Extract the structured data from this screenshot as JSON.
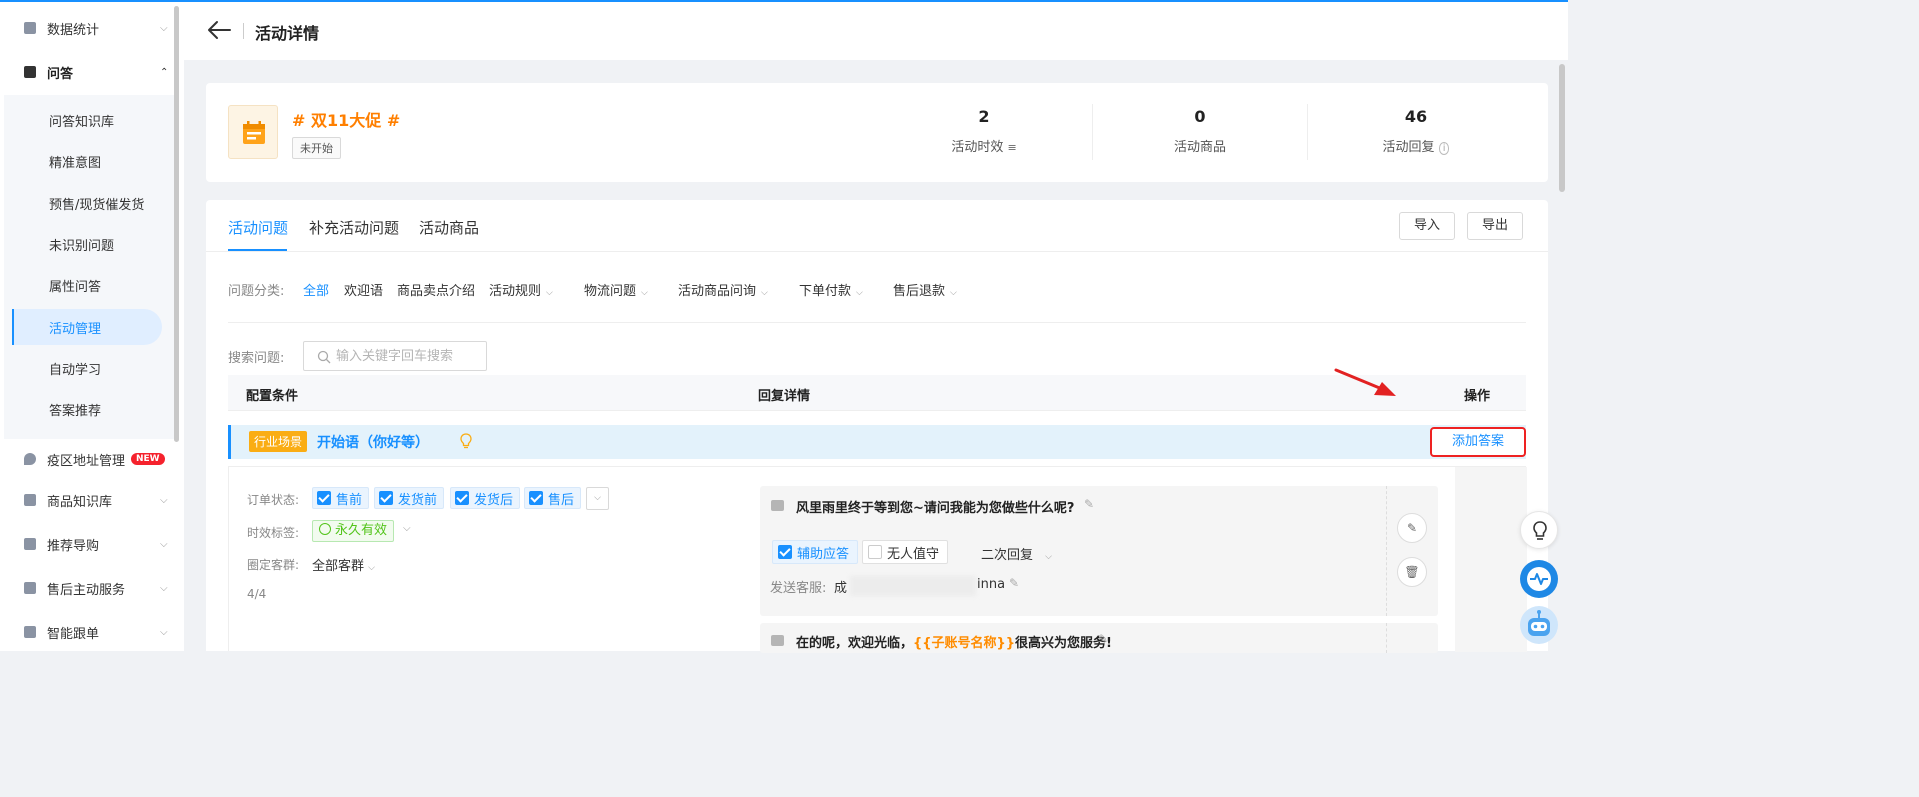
{
  "sidebar": {
    "items": [
      {
        "label": "数据统计",
        "icon": "chart-icon"
      },
      {
        "label": "问答",
        "icon": "chat-icon"
      },
      {
        "label": "疫区地址管理",
        "icon": "location-icon",
        "badge": "NEW"
      },
      {
        "label": "商品知识库",
        "icon": "shop-icon"
      },
      {
        "label": "推荐导购",
        "icon": "recommend-icon"
      },
      {
        "label": "售后主动服务",
        "icon": "service-icon"
      },
      {
        "label": "智能跟单",
        "icon": "order-icon"
      }
    ],
    "sub_items": [
      {
        "label": "问答知识库"
      },
      {
        "label": "精准意图"
      },
      {
        "label": "预售/现货催发货"
      },
      {
        "label": "未识别问题"
      },
      {
        "label": "属性问答"
      },
      {
        "label": "活动管理"
      },
      {
        "label": "自动学习"
      },
      {
        "label": "答案推荐"
      }
    ]
  },
  "header": {
    "title": "活动详情"
  },
  "activity": {
    "name": "# 双11大促 #",
    "status": "未开始",
    "stats": [
      {
        "value": "2",
        "label": "活动时效"
      },
      {
        "value": "0",
        "label": "活动商品"
      },
      {
        "value": "46",
        "label": "活动回复"
      }
    ]
  },
  "tabs": [
    {
      "label": "活动问题"
    },
    {
      "label": "补充活动问题"
    },
    {
      "label": "活动商品"
    }
  ],
  "buttons": {
    "import": "导入",
    "export": "导出"
  },
  "filters": {
    "label": "问题分类:",
    "items": [
      {
        "label": "全部"
      },
      {
        "label": "欢迎语"
      },
      {
        "label": "商品卖点介绍"
      },
      {
        "label": "活动规则"
      },
      {
        "label": "物流问题"
      },
      {
        "label": "活动商品问询"
      },
      {
        "label": "下单付款"
      },
      {
        "label": "售后退款"
      }
    ]
  },
  "search": {
    "label": "搜索问题:",
    "placeholder": "输入关键字回车搜索",
    "value": ""
  },
  "table": {
    "col_config": "配置条件",
    "col_reply": "回复详情",
    "col_ops": "操作"
  },
  "scene": {
    "tag": "行业场景",
    "title": "开始语（你好等）",
    "add_answer": "添加答案"
  },
  "config": {
    "order_status_label": "订单状态:",
    "order_status": [
      {
        "label": "售前"
      },
      {
        "label": "发货前"
      },
      {
        "label": "发货后"
      },
      {
        "label": "售后"
      }
    ],
    "time_label": "时效标签:",
    "time_value": "永久有效",
    "group_label": "圈定客群:",
    "group_value": "全部客群",
    "count": "4/4"
  },
  "replies": [
    {
      "text": "风里雨里终于等到您~请问我能为您做些什么呢?",
      "assist": "辅助应答",
      "unattended": "无人值守",
      "second": "二次回复",
      "staff_label": "发送客服:",
      "staff_prefix": "成",
      "staff_suffix": "inna"
    },
    {
      "text_pre": "在的呢，欢迎光临，",
      "text_var": "{{子账号名称}}",
      "text_post": "很高兴为您服务!"
    }
  ],
  "colors": {
    "accent": "#1890ff",
    "brand_orange": "#ff7f00",
    "annotation_red": "#e22222"
  }
}
